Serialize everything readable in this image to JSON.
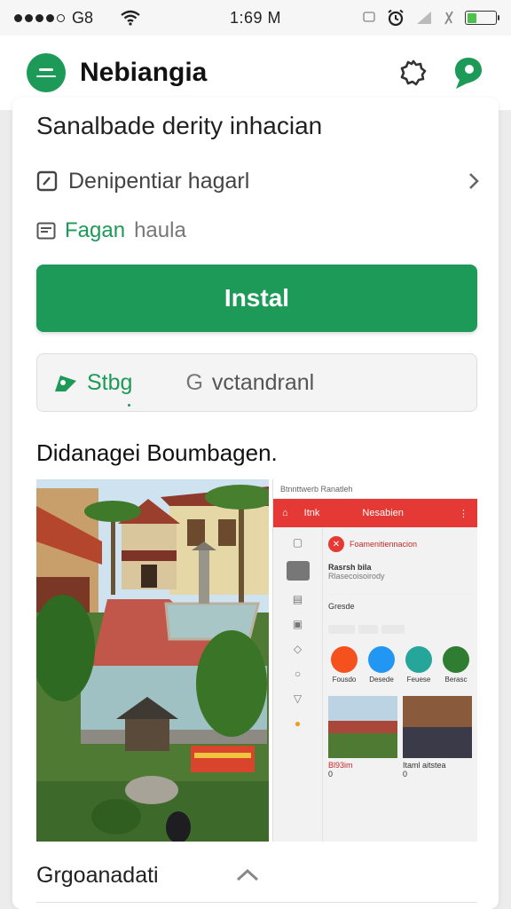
{
  "status_bar": {
    "carrier": "G8",
    "time": "1:69 M",
    "battery_level": 0.35
  },
  "app_bar": {
    "title": "Nebiangia"
  },
  "listing": {
    "heading": "Sanalbade derity inhacian",
    "row1_label": "Denipentiar hagarl",
    "row2_label_green": "Fagan",
    "row2_label_grey": "haula",
    "install_label": "Instal",
    "tab_active": "Stbg",
    "tab_inactive": "vctandranl",
    "tab_inactive_icon_text": "G",
    "section_title": "Didanagei Boumbagen.",
    "bottom_label": "Grgoanadati"
  },
  "phone_screenshot": {
    "status": "Btnnttwerb Ranatleh",
    "nav_left": "Itnk",
    "nav_title": "Nesabien",
    "notice": "Foamenitiennacion",
    "user_name": "Rasrsh bila",
    "user_sub": "Rlasecoisoirody",
    "section": "Gresde",
    "apps": [
      "Fousdo",
      "Desede",
      "Feuese",
      "Berasc"
    ],
    "card1_title": "Bl93im",
    "card1_count": "0",
    "card2_title": "Itaml aitstea",
    "card2_count": "0"
  },
  "colors": {
    "accent": "#1d9a57",
    "phone_header": "#e53935"
  }
}
